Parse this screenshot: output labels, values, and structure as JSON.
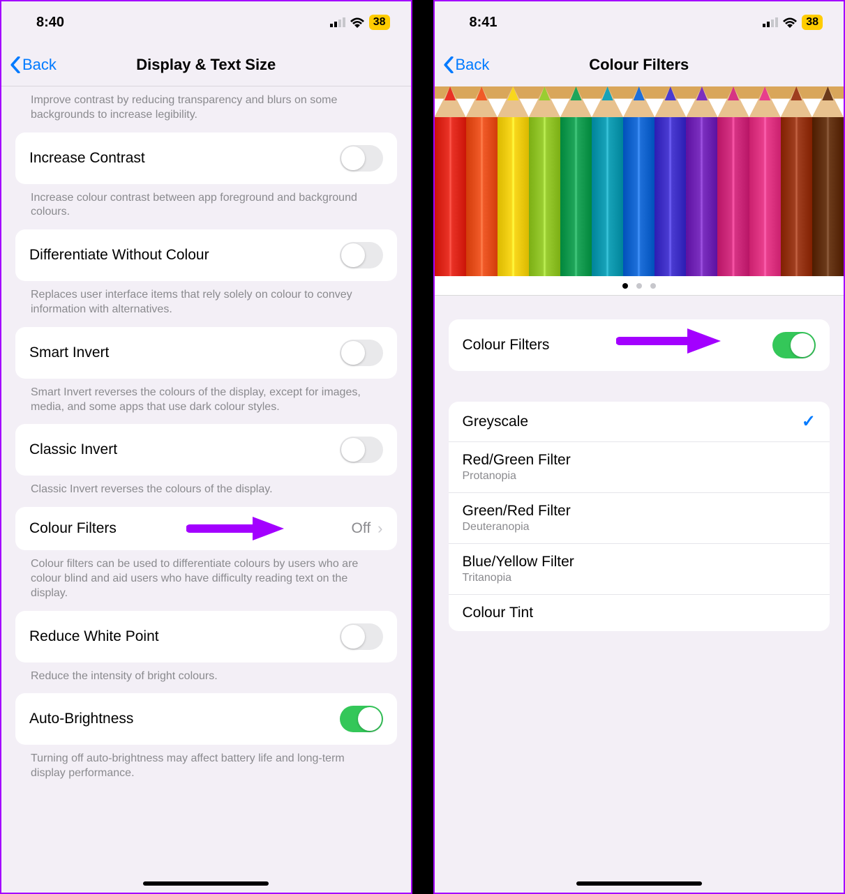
{
  "left": {
    "status": {
      "time": "8:40",
      "battery": "38"
    },
    "nav": {
      "back": "Back",
      "title": "Display & Text Size"
    },
    "transparency_footer": "Improve contrast by reducing transparency and blurs on some backgrounds to increase legibility.",
    "rows": {
      "increaseContrast": {
        "label": "Increase Contrast",
        "footer": "Increase colour contrast between app foreground and background colours."
      },
      "diffWithoutColour": {
        "label": "Differentiate Without Colour",
        "footer": "Replaces user interface items that rely solely on colour to convey information with alternatives."
      },
      "smartInvert": {
        "label": "Smart Invert",
        "footer": "Smart Invert reverses the colours of the display, except for images, media, and some apps that use dark colour styles."
      },
      "classicInvert": {
        "label": "Classic Invert",
        "footer": "Classic Invert reverses the colours of the display."
      },
      "colourFilters": {
        "label": "Colour Filters",
        "value": "Off",
        "footer": "Colour filters can be used to differentiate colours by users who are colour blind and aid users who have difficulty reading text on the display."
      },
      "reduceWhitePoint": {
        "label": "Reduce White Point",
        "footer": "Reduce the intensity of bright colours."
      },
      "autoBrightness": {
        "label": "Auto-Brightness",
        "footer": "Turning off auto-brightness may affect battery life and long-term display performance."
      }
    }
  },
  "right": {
    "status": {
      "time": "8:41",
      "battery": "38"
    },
    "nav": {
      "back": "Back",
      "title": "Colour Filters"
    },
    "toggleLabel": "Colour Filters",
    "options": {
      "greyscale": {
        "label": "Greyscale"
      },
      "redgreen": {
        "label": "Red/Green Filter",
        "sub": "Protanopia"
      },
      "greenred": {
        "label": "Green/Red Filter",
        "sub": "Deuteranopia"
      },
      "blueyellow": {
        "label": "Blue/Yellow Filter",
        "sub": "Tritanopia"
      },
      "tint": {
        "label": "Colour Tint"
      }
    },
    "pencilColors": [
      "#e93226",
      "#f05a28",
      "#f9d71c",
      "#9acd32",
      "#1fa55a",
      "#17a2b8",
      "#1e6fd9",
      "#4a3bd1",
      "#7b2fbf",
      "#d63384",
      "#e83e8c",
      "#9f3e1f",
      "#6b3a1a"
    ]
  },
  "annotation": {
    "arrowColor": "#a300ff"
  }
}
